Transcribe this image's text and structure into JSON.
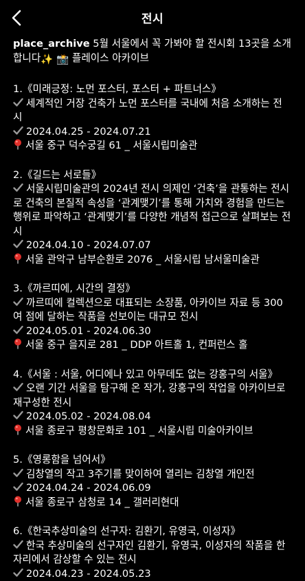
{
  "header": {
    "title": "전시"
  },
  "caption": {
    "username": "place_archive",
    "text": " 5월 서울에서 꼭 가봐야 할 전시회 13곳을 소개합니다",
    "sparkles": "✨",
    "camera": "📸",
    "tail": " 플레이스 아카이브"
  },
  "entries": [
    {
      "title": "1.《미래긍정: 노먼 포스터, 포스터 + 파트너스》",
      "description": "세계적인 거장 건축가 노먼 포스터를 국내에 처음 소개하는 전시",
      "dates": "2024.04.25 - 2024.07.21",
      "location": "서울 중구 덕수궁길 61 _ 서울시립미술관"
    },
    {
      "title": "2.《길드는 서로들》",
      "description": "서울시립미술관의 2024년 전시 의제인 ‘건축’을 관통하는 전시로 건축의 본질적 속성을 ‘관계맺기’를 통해 가치와 경험을 만드는 행위로 파악하고 ‘관계맺기’를 다양한 개념적 접근으로 살펴보는 전시",
      "dates": "2024.04.10 - 2024.07.07",
      "location": "서울 관악구 남부순환로 2076 _ 서울시립 남서울미술관"
    },
    {
      "title": "3.《까르띠에, 시간의 결정》",
      "description": "까르띠에 컬렉션으로 대표되는 소장품, 아카이브 자료 등 300여 점에 달하는 작품을 선보이는 대규모 전시",
      "dates": "2024.05.01 - 2024.06.30",
      "location": "서울 중구 을지로 281 _ DDP 아트홀 1, 컨퍼런스 홀"
    },
    {
      "title": "4.《서울 : 서울, 어디에나 있고 아무데도 없는 강홍구의 서울》",
      "description": "오랜 기간 서울을 탐구해 온 작가, 강홍구의 작업을 아카이브로 재구성한 전시",
      "dates": "2024.05.02 - 2024.08.04",
      "location": "서울 종로구 평창문화로 101 _ 서울시립 미술아카이브"
    },
    {
      "title": "5.《영롱함을 넘어서》",
      "description": "김창열의 작고 3주기를 맞이하여 열리는 김창열 개인전",
      "dates": "2024.04.24 - 2024.06.09",
      "location": "서울 종로구 삼청로 14 _ 갤러리현대"
    },
    {
      "title": "6.《한국추상미술의 선구자: 김환기, 유영국, 이성자》",
      "description": "한국 추상미술의 선구자인 김환기, 유영국, 이성자의 작품을 한자리에서 감상할 수 있는 전시",
      "dates": "2024.04.23 - 2024.05.23",
      "location": ""
    }
  ]
}
